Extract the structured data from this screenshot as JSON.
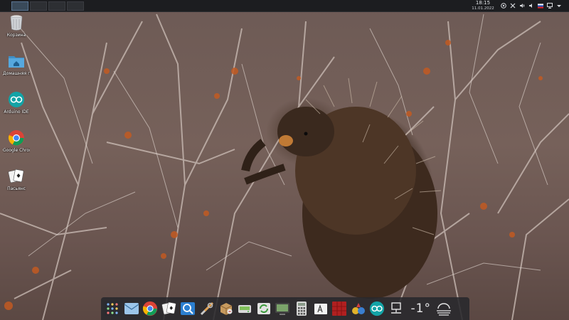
{
  "top_panel": {
    "clock": {
      "time": "18:15",
      "date": "11.01.2022"
    },
    "tray_icons": [
      "network-icon",
      "tools-icon",
      "volume-icon",
      "speaker-icon",
      "flag-ru-icon",
      "display-icon",
      "chevron-down-icon"
    ],
    "desktop_count": 4,
    "colors": {
      "panel": "#1c1d20",
      "active_desktop": "#5b7593"
    }
  },
  "desktop_icons": [
    {
      "name": "trash",
      "label": "Корзина",
      "icon": "trash-icon"
    },
    {
      "name": "home-folder",
      "label": "Домашняя папка",
      "icon": "folder-home-icon"
    },
    {
      "name": "arduino",
      "label": "Arduino IDE",
      "icon": "arduino-icon"
    },
    {
      "name": "chrome",
      "label": "Google Chrome",
      "icon": "chrome-icon"
    },
    {
      "name": "solitaire",
      "label": "Пасьянс",
      "icon": "cards-icon"
    }
  ],
  "dock": {
    "items": [
      "app-grid-icon",
      "mail-icon",
      "chrome-icon",
      "cards-icon",
      "photo-viewer-icon",
      "tools-icon",
      "package-icon",
      "disk-icon",
      "update-icon",
      "screen-icon",
      "calculator-icon",
      "text-editor-icon",
      "terminal-red-icon",
      "games-icon",
      "arduino-icon",
      "network-icon"
    ],
    "weather": {
      "temperature": "-1°",
      "icon": "fog-icon"
    }
  }
}
